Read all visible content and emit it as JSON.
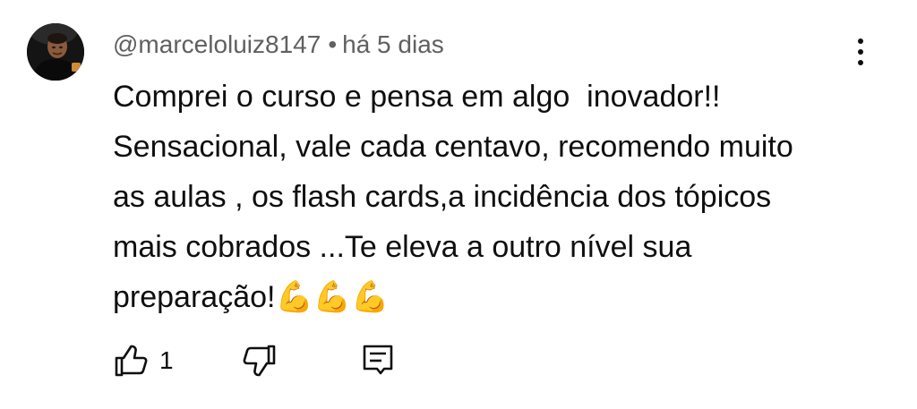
{
  "comment": {
    "author": "@marceloluiz8147",
    "separator": "•",
    "timestamp": "há 5 dias",
    "lines": [
      "Comprei o curso e pensa em algo  inovador!!",
      "Sensacional, vale cada centavo, recomendo muito",
      "as aulas , os flash cards,a incidência dos tópicos",
      "mais cobrados ...Te eleva a outro nível sua",
      "preparação!💪💪💪"
    ],
    "like_count": "1"
  },
  "icons": {
    "avatar": "user-avatar-photo",
    "more": "vertical-dots-icon",
    "like": "thumbs-up-icon",
    "dislike": "thumbs-down-icon",
    "reply": "reply-comment-icon"
  },
  "colors": {
    "text": "#0f0f0f",
    "meta": "#606060",
    "icon": "#0f0f0f",
    "emoji": "#f5b71b"
  }
}
